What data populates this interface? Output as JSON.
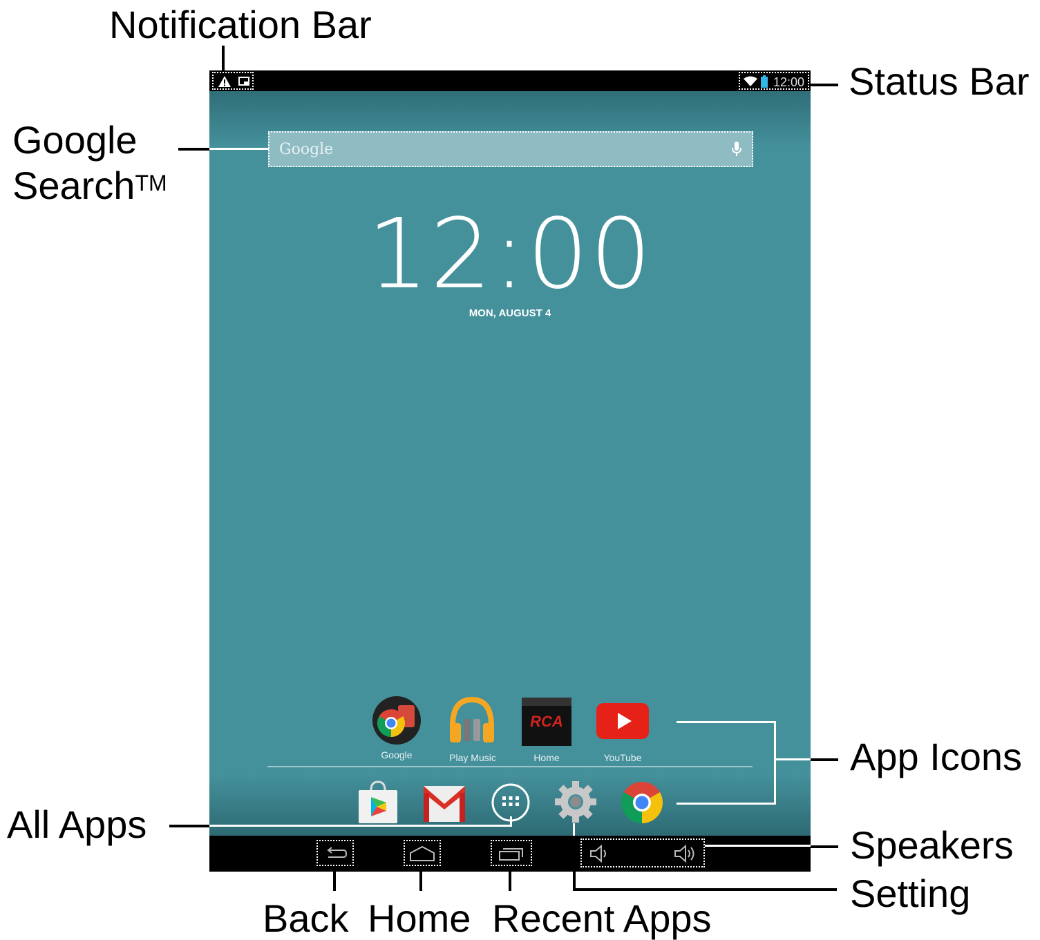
{
  "callouts": {
    "notification_bar": "Notification Bar",
    "status_bar": "Status Bar",
    "google_search_line1": "Google",
    "google_search_line2": "Search",
    "google_search_tm": "TM",
    "app_icons": "App Icons",
    "all_apps": "All Apps",
    "speakers": "Speakers",
    "setting": "Setting",
    "back": "Back",
    "home": "Home",
    "recent_apps": "Recent Apps"
  },
  "screen": {
    "status_time": "12:00",
    "search_placeholder": "Google",
    "clock": "12:00",
    "date": "MON, AUGUST 4",
    "apps": [
      {
        "label": "Google",
        "icon": "google-folder-icon"
      },
      {
        "label": "Play Music",
        "icon": "play-music-icon"
      },
      {
        "label": "Home",
        "icon": "rca-home-icon",
        "logo_text": "RCA"
      },
      {
        "label": "YouTube",
        "icon": "youtube-icon"
      }
    ],
    "dock": [
      {
        "icon": "play-store-icon"
      },
      {
        "icon": "gmail-icon"
      },
      {
        "icon": "all-apps-icon"
      },
      {
        "icon": "settings-gear-icon"
      },
      {
        "icon": "chrome-icon"
      }
    ]
  },
  "colors": {
    "wallpaper": "#44909b",
    "bars": "#000000",
    "youtube_red": "#e62117"
  }
}
